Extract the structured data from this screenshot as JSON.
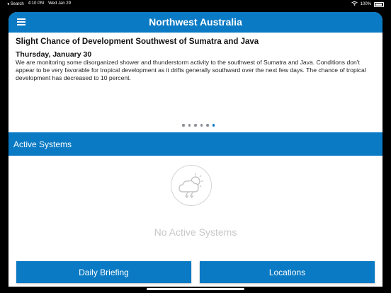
{
  "status_bar": {
    "back_label": "◂ Search",
    "time": "4:10 PM",
    "date": "Wed Jan 29",
    "battery": "100%"
  },
  "nav": {
    "title": "Northwest Australia"
  },
  "outlook": {
    "title": "Slight Chance of Development Southwest of Sumatra and Java",
    "date": "Thursday, January 30",
    "text": "We are monitoring some disorganized shower and thunderstorm activity to the southwest of Sumatra and Java. Conditions don't appear to be very favorable for tropical development as it drifts generally southward over the next few days. The chance of tropical development has decreased to 10 percent.",
    "pages_total": 6,
    "active_page": 6
  },
  "active_systems": {
    "header": "Active Systems",
    "empty_label": "No Active Systems",
    "empty_icon": "storm-cloud-icon"
  },
  "buttons": {
    "daily_briefing": "Daily Briefing",
    "locations": "Locations"
  },
  "colors": {
    "accent": "#0a7ac4",
    "muted": "#c8c8c8"
  }
}
